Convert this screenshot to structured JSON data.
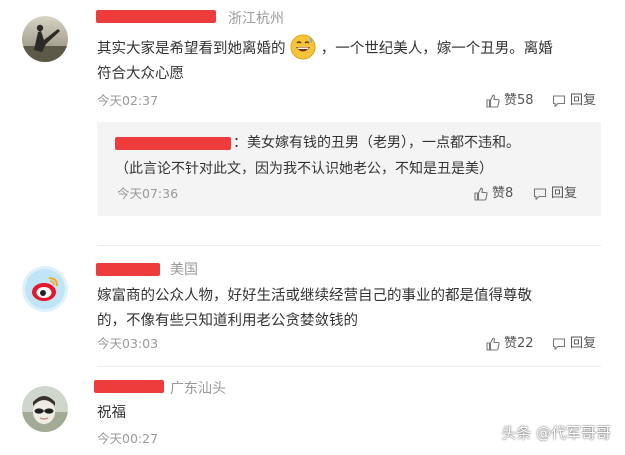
{
  "comments": [
    {
      "location": "浙江杭州",
      "text_before_emoji": "其实大家是希望看到她离婚的",
      "emoji": "grinning-sweat-emoji",
      "text_after_emoji": "，一个世纪美人，嫁一个丑男。离婚",
      "text_line2": "符合大众心愿",
      "time": "今天02:37",
      "likes_label": "赞58",
      "reply_label": "回复",
      "reply": {
        "text_line1": "：美女嫁有钱的丑男（老男），一点都不违和。",
        "text_line2": "（此言论不针对此文，因为我不认识她老公，不知是丑是美）",
        "time": "今天07:36",
        "likes_label": "赞8",
        "reply_label": "回复"
      }
    },
    {
      "location": "美国",
      "text_line1": "嫁富商的公众人物，好好生活或继续经营自己的事业的都是值得尊敬",
      "text_line2": "的，不像有些只知道利用老公贪婪敛钱的",
      "time": "今天03:03",
      "likes_label": "赞22",
      "reply_label": "回复"
    },
    {
      "location": "广东汕头",
      "text_line1": "祝福",
      "time": "今天00:27"
    }
  ],
  "watermark": "头条 @代军哥哥",
  "colors": {
    "redaction": "#ee3b3b",
    "reply_bg": "#f4f4f4",
    "muted": "#999999"
  }
}
